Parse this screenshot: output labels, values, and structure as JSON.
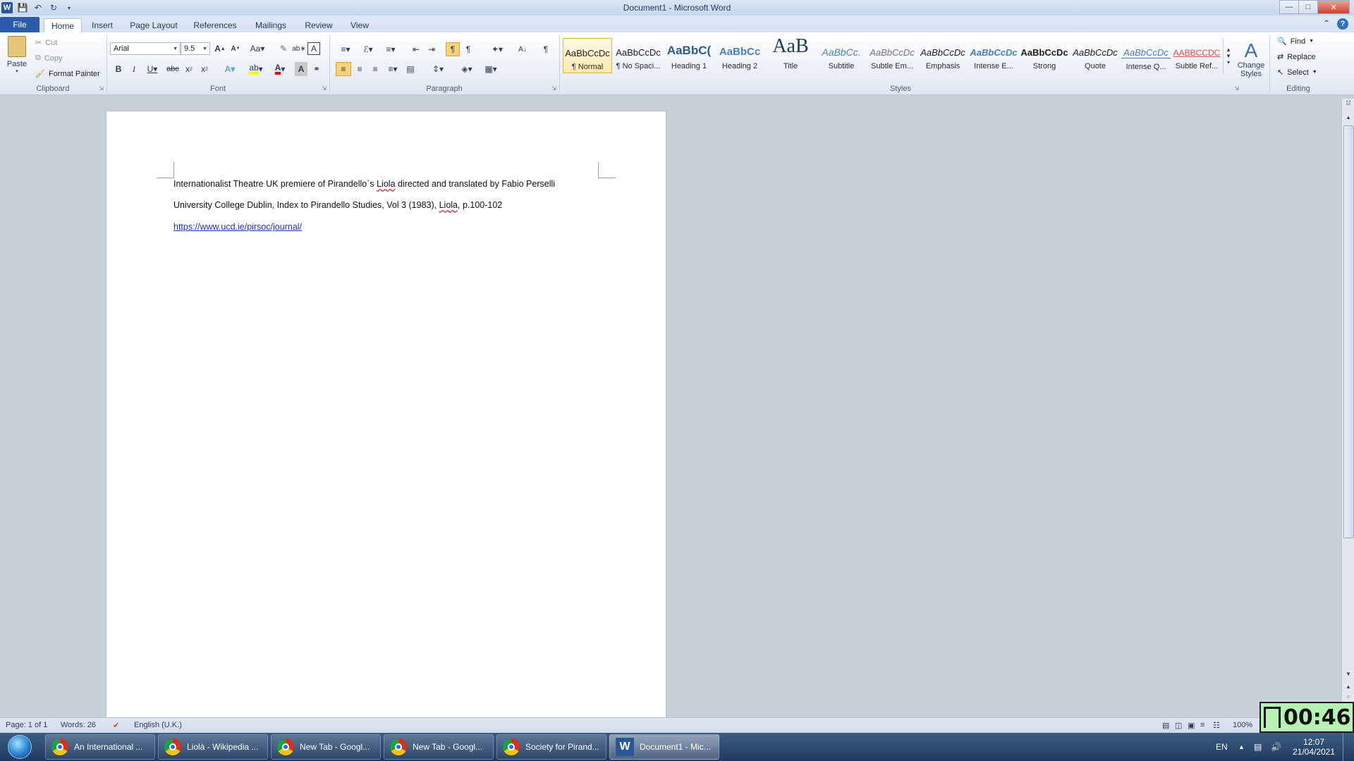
{
  "window": {
    "title": "Document1 - Microsoft Word"
  },
  "tabs": [
    "File",
    "Home",
    "Insert",
    "Page Layout",
    "References",
    "Mailings",
    "Review",
    "View"
  ],
  "clipboard": {
    "paste": "Paste",
    "cut": "Cut",
    "copy": "Copy",
    "format_painter": "Format Painter",
    "label": "Clipboard"
  },
  "font": {
    "name": "Arial",
    "size": "9.5",
    "label": "Font"
  },
  "paragraph": {
    "label": "Paragraph"
  },
  "styles": {
    "label": "Styles",
    "items": [
      {
        "sample": "AaBbCcDc",
        "name": "¶ Normal"
      },
      {
        "sample": "AaBbCcDc",
        "name": "¶ No Spaci..."
      },
      {
        "sample": "AaBbC(",
        "name": "Heading 1"
      },
      {
        "sample": "AaBbCc",
        "name": "Heading 2"
      },
      {
        "sample": "AaB",
        "name": "Title"
      },
      {
        "sample": "AaBbCc.",
        "name": "Subtitle"
      },
      {
        "sample": "AaBbCcDc",
        "name": "Subtle Em..."
      },
      {
        "sample": "AaBbCcDc",
        "name": "Emphasis"
      },
      {
        "sample": "AaBbCcDc",
        "name": "Intense E..."
      },
      {
        "sample": "AaBbCcDc",
        "name": "Strong"
      },
      {
        "sample": "AaBbCcDc",
        "name": "Quote"
      },
      {
        "sample": "AaBbCcDc",
        "name": "Intense Q..."
      },
      {
        "sample": "AABBCCDC",
        "name": "Subtle Ref..."
      }
    ],
    "change_styles": "Change Styles"
  },
  "editing": {
    "find": "Find",
    "replace": "Replace",
    "select": "Select",
    "label": "Editing"
  },
  "document": {
    "line1_pre": "Internationalist Theatre UK premiere of Pirandello`s ",
    "line1_liola": "Liola",
    "line1_post": " directed and translated by Fabio Perselli",
    "line2_pre": "University College Dublin, Index to Pirandello Studies, Vol 3 (1983), ",
    "line2_liola": "Liola",
    "line2_post": ", p.100-102",
    "link": "https://www.ucd.ie/pirsoc/journal/"
  },
  "status": {
    "page": "Page: 1 of 1",
    "words": "Words: 26",
    "language": "English (U.K.)",
    "zoom": "100%"
  },
  "timer": "00:46",
  "taskbar": {
    "items": [
      "An International ...",
      "Liolà - Wikipedia ...",
      "New Tab - Googl...",
      "New Tab - Googl...",
      "Society for Pirand...",
      "Document1 - Mic..."
    ],
    "lang": "EN",
    "time": "12:07",
    "date": "21/04/2021"
  }
}
